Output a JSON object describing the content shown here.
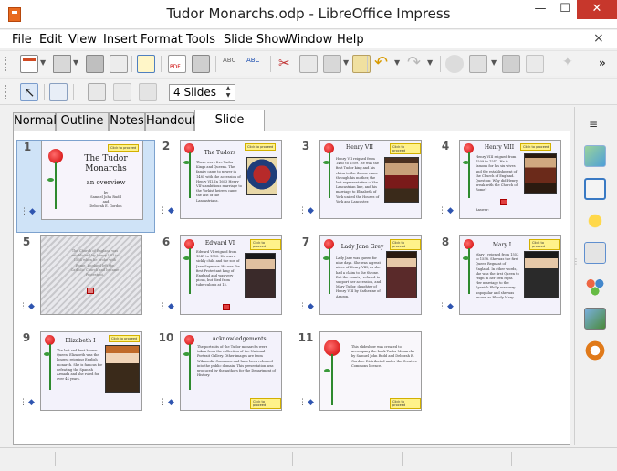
{
  "window": {
    "title": "Tudor Monarchs.odp - LibreOffice Impress",
    "app_icon": "impress-icon",
    "controls": [
      "—",
      "☐",
      "✕"
    ]
  },
  "menu": {
    "items": [
      "File",
      "Edit",
      "View",
      "Insert",
      "Format",
      "Tools",
      "Slide Show",
      "Window",
      "Help"
    ],
    "close_doc": "×"
  },
  "toolbar1": {
    "icons": [
      "new-icon",
      "open-icon",
      "save-icon",
      "email-icon",
      "edit-mode-icon",
      "export-pdf-icon",
      "print-icon",
      "spellcheck-icon",
      "autospell-icon",
      "cut-icon",
      "copy-icon",
      "paste-icon",
      "clone-format-icon",
      "undo-icon",
      "redo-icon",
      "chart-icon",
      "table-icon",
      "film-icon",
      "star-icon"
    ],
    "more": "»"
  },
  "toolbar2": {
    "slides_per_row": "4 Slides"
  },
  "tabs": [
    {
      "label": "Normal",
      "active": false
    },
    {
      "label": "Outline",
      "active": false
    },
    {
      "label": "Notes",
      "active": false
    },
    {
      "label": "Handout",
      "active": false
    },
    {
      "label": "Slide Sorter",
      "active": true
    }
  ],
  "slides": [
    {
      "num": "1",
      "title_line1": "The Tudor",
      "title_line2": "Monarchs",
      "subtitle": "an overview",
      "author_line1": "by",
      "author_line2": "Samuel John Rudd",
      "author_line3": "and",
      "author_line4": "Deborah E. Gordon",
      "tag": "Click to proceed"
    },
    {
      "num": "2",
      "title": "The Tudors",
      "tag": "Click to proceed",
      "body": "There were five Tudor Kings and Queens. The family came to power in 1485 with the accession of Henry VII. In 1603 Henry VII's ambitious marriage to the Yorkist heiress came the last of the Lancastrians."
    },
    {
      "num": "3",
      "title": "Henry VII",
      "tag": "Click to proceed",
      "body": "Henry VII reigned from 1485 to 1509. He was the first Tudor king and his claim to the throne came through his mother, the last representative of the Lancastrian line, and his marriage to Elizabeth of York united the Houses of York and Lancaster."
    },
    {
      "num": "4",
      "title": "Henry VIII",
      "tag": "Click to proceed",
      "body": "Henry VIII reigned from 1509 to 1547. He is famous for his six wives and the establishment of the Church of England. Question: Why did Henry break with the Church of Rome?",
      "answer": "Answer:"
    },
    {
      "num": "5",
      "title": "",
      "tag": "",
      "body": "The Church of England was established by Henry VIII in 1534 when he broke with Rome. England left the Catholic Church and became Protestant."
    },
    {
      "num": "6",
      "title": "Edward VI",
      "tag": "Click to proceed",
      "body": "Edward VI reigned from 1547 to 1553. He was a sickly child and the son of Jane Seymour. He was the first Protestant king of England and was very pious, but died from tuberculosis at 15."
    },
    {
      "num": "7",
      "title": "Lady Jane Grey",
      "tag": "Click to proceed",
      "body": "Lady Jane was queen for nine days. She was a great niece of Henry VIII, as she had a claim to the throne. But the country refused to support her accession, and Mary Tudor, daughter of Henry VIII by Catherine of Aragon."
    },
    {
      "num": "8",
      "title": "Mary I",
      "tag": "Click to proceed",
      "body": "Mary I reigned from 1553 to 1558. She was the first Queen Regnant of England. In other words, she was the first Queen to reign in her own right. Her marriage to the Spanish Philip was very unpopular and she was known as Bloody Mary."
    },
    {
      "num": "9",
      "title": "Elizabeth I",
      "tag": "Click to proceed",
      "body": "The last and best known Queen, Elizabeth was the longest reigning English monarch. She is famous for defeating the Spanish Armada and she ruled for over 44 years."
    },
    {
      "num": "10",
      "title": "Acknowledgements",
      "tag": "Click to proceed",
      "body": "The portraits of the Tudor monarchs were taken from the collection of the National Portrait Gallery. Other images are from Wikimedia Commons and have been released into the public domain. This presentation was produced by the authors for the Department of History."
    },
    {
      "num": "11",
      "title": "",
      "tag": "Click to proceed",
      "body": "This slideshow was created to accompany the book Tudor Monarchs by Samuel John Rudd and Deborah E. Gordon. Distributed under the Creative Commons licence."
    }
  ],
  "sidebar": {
    "menu": "≡",
    "icons": [
      "properties-icon",
      "slide-transition-icon",
      "animation-icon",
      "master-slides-icon",
      "styles-icon",
      "gallery-icon",
      "navigator-icon"
    ]
  },
  "colors": {
    "selected_slide": "#cfe3f7",
    "tag_yellow": "#fff28a",
    "close_red": "#c7372c"
  }
}
